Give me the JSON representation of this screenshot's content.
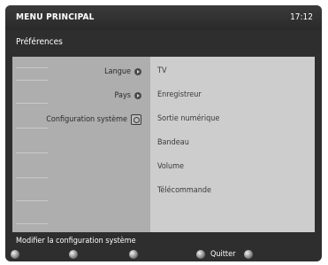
{
  "header": {
    "title": "MENU PRINCIPAL",
    "clock": "17:12"
  },
  "section_title": "Préférences",
  "left_menu": {
    "items": [
      {
        "label": "Langue",
        "icon": "arrow-icon"
      },
      {
        "label": "Pays",
        "icon": "arrow-icon"
      },
      {
        "label": "Configuration système",
        "icon": "config-icon"
      }
    ]
  },
  "right_menu": {
    "items": [
      {
        "label": "TV"
      },
      {
        "label": "Enregistreur"
      },
      {
        "label": "Sortie numérique"
      },
      {
        "label": "Bandeau"
      },
      {
        "label": "Volume"
      },
      {
        "label": "Télécommande"
      }
    ]
  },
  "status_text": "Modifier la configuration système",
  "footer": {
    "quit_label": "Quitter"
  },
  "colors": {
    "background": "#2e2e2e",
    "left_pane": "#aeaeae",
    "right_pane": "#cdcdcd",
    "text_light": "#ffffff",
    "text_dark": "#3a3a3a"
  }
}
